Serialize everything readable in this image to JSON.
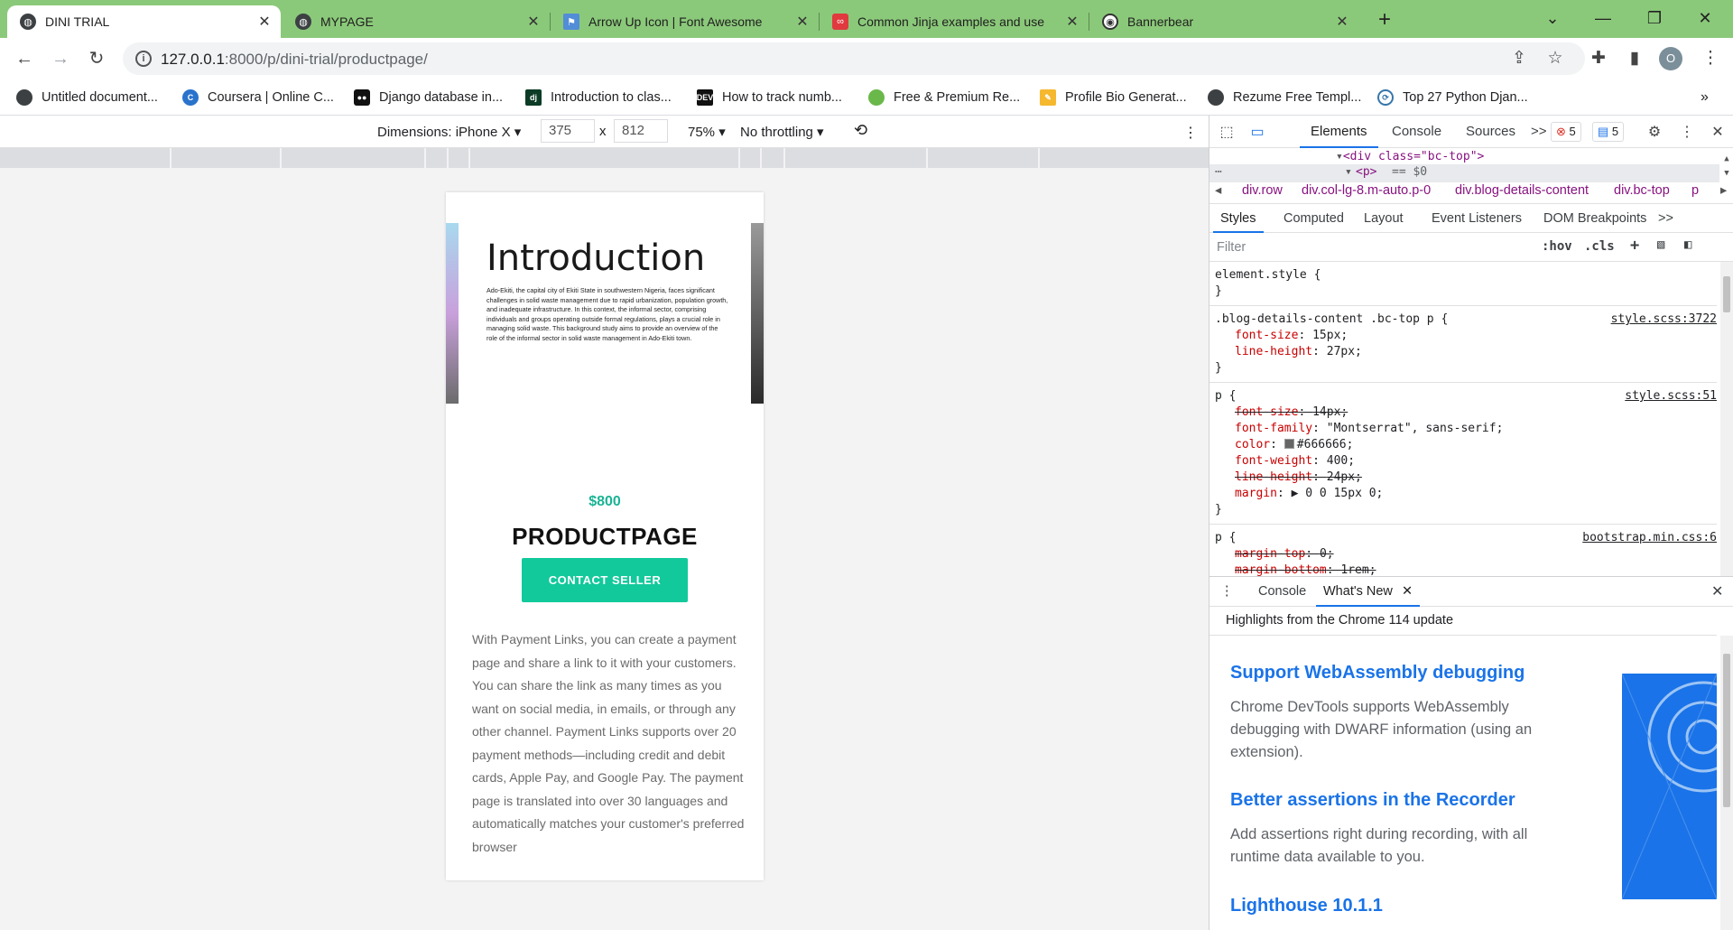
{
  "browser": {
    "tabs": [
      {
        "title": "DINI TRIAL",
        "active": true
      },
      {
        "title": "MYPAGE",
        "active": false
      },
      {
        "title": "Arrow Up Icon | Font Awesome",
        "active": false
      },
      {
        "title": "Common Jinja examples and use",
        "active": false
      },
      {
        "title": "Bannerbear",
        "active": false
      }
    ],
    "url_host": "127.0.0.1",
    "url_rest": ":8000/p/dini-trial/productpage/",
    "profile_initial": "O",
    "accent_color": "#8bc97a",
    "bookmarks": [
      {
        "label": "Untitled document..."
      },
      {
        "label": "Coursera | Online C..."
      },
      {
        "label": "Django database in..."
      },
      {
        "label": "Introduction to clas..."
      },
      {
        "label": "How to track numb..."
      },
      {
        "label": "Free & Premium Re..."
      },
      {
        "label": "Profile Bio Generat..."
      },
      {
        "label": "Rezume Free Templ..."
      },
      {
        "label": "Top 27 Python Djan..."
      }
    ]
  },
  "device_toolbar": {
    "dimensions_label": "Dimensions: iPhone X",
    "width": "375",
    "times": "x",
    "height": "812",
    "zoom": "75%",
    "throttling": "No throttling"
  },
  "page": {
    "intro_title": "Introduction",
    "intro_text": "Ado-Ekiti, the capital city of Ekiti State in southwestern Nigeria, faces significant challenges in solid waste management due to rapid urbanization, population growth, and inadequate infrastructure. In this context, the informal sector, comprising individuals and groups operating outside formal regulations, plays a crucial role in managing solid waste. This background study aims to provide an overview of the role of the informal sector in solid waste management in Ado-Ekiti town.",
    "price": "$800",
    "product_title": "PRODUCTPAGE",
    "contact_button": "CONTACT SELLER",
    "description": "With Payment Links, you can create a payment page and share a link to it with your customers. You can share the link as many times as you want on social media, in emails, or through any other channel. Payment Links supports over 20 payment methods—including credit and debit cards, Apple Pay, and Google Pay. The payment page is translated into over 30 languages and automatically matches your customer's preferred browser",
    "accent_color": "#12c99b"
  },
  "devtools": {
    "tabs": [
      "Elements",
      "Console",
      "Sources",
      ">>"
    ],
    "errors": "5",
    "messages": "5",
    "dom_line1": "<div class=\"bc-top\">",
    "dom_line2_tag": "<p>",
    "dom_line2_eq": "== $0",
    "breadcrumbs": [
      "div.row",
      "div.col-lg-8.m-auto.p-0",
      "div.blog-details-content",
      "div.bc-top",
      "p"
    ],
    "subtabs": [
      "Styles",
      "Computed",
      "Layout",
      "Event Listeners",
      "DOM Breakpoints",
      ">>"
    ],
    "filter_placeholder": "Filter",
    "hov": ":hov",
    "cls": ".cls",
    "rules": [
      {
        "selector": "element.style {",
        "source": "",
        "props": [],
        "close": "}"
      },
      {
        "selector": ".blog-details-content .bc-top p {",
        "source": "style.scss:3722",
        "props": [
          {
            "name": "font-size",
            "value": "15px;",
            "struck": false
          },
          {
            "name": "line-height",
            "value": "27px;",
            "struck": false
          }
        ],
        "close": "}"
      },
      {
        "selector": "p {",
        "source": "style.scss:51",
        "props": [
          {
            "name": "font-size",
            "value": "14px;",
            "struck": true
          },
          {
            "name": "font-family",
            "value": "\"Montserrat\", sans-serif;",
            "struck": false
          },
          {
            "name": "color",
            "value": "#666666;",
            "struck": false,
            "swatch": true
          },
          {
            "name": "font-weight",
            "value": "400;",
            "struck": false
          },
          {
            "name": "line-height",
            "value": "24px;",
            "struck": true
          },
          {
            "name": "margin",
            "value": "▶ 0 0 15px 0;",
            "struck": false
          }
        ],
        "close": "}"
      },
      {
        "selector": "p {",
        "source": "bootstrap.min.css:6",
        "props": [
          {
            "name": "margin-top",
            "value": "0;",
            "struck": true
          },
          {
            "name": "margin-bottom",
            "value": "1rem;",
            "struck": true
          }
        ],
        "close": ""
      }
    ],
    "drawer_tabs": [
      "Console",
      "What's New"
    ],
    "whatsnew_heading": "Highlights from the Chrome 114 update",
    "whatsnew_items": [
      {
        "title": "Support WebAssembly debugging",
        "body": "Chrome DevTools supports WebAssembly debugging with DWARF information (using an extension)."
      },
      {
        "title": "Better assertions in the Recorder",
        "body": "Add assertions right during recording, with all runtime data available to you."
      },
      {
        "title": "Lighthouse 10.1.1",
        "body": ""
      }
    ]
  }
}
